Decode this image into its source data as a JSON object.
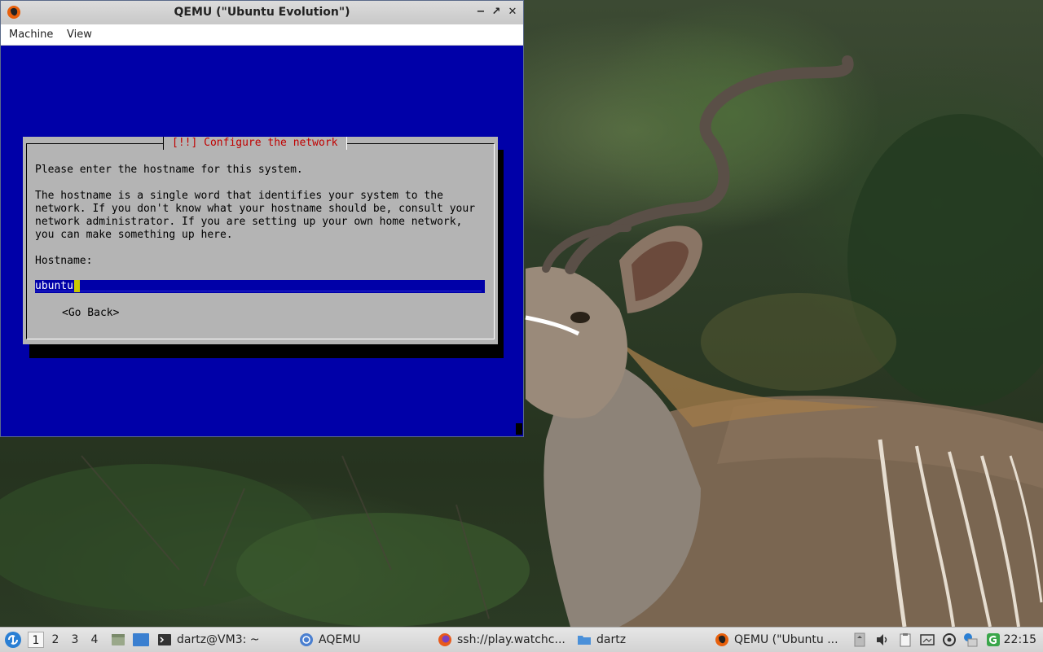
{
  "window": {
    "title": "QEMU (\"Ubuntu Evolution\")",
    "controls": {
      "minimize": "−",
      "maximize": "↗",
      "close": "✕"
    }
  },
  "menu": {
    "machine": "Machine",
    "view": "View"
  },
  "installer": {
    "dialog_title": "[!!] Configure the network",
    "prompt": "Please enter the hostname for this system.",
    "description_lines": [
      "The hostname is a single word that identifies your system to the",
      "network. If you don't know what your hostname should be, consult your",
      "network administrator. If you are setting up your own home network,",
      "you can make something up here."
    ],
    "field_label": "Hostname:",
    "hostname_value": "ubuntu",
    "go_back": "<Go Back>"
  },
  "taskbar": {
    "desktops": [
      "1",
      "2",
      "3",
      "4"
    ],
    "active_desktop": "1",
    "tasks": [
      {
        "label": "dartz@VM3: ~",
        "icon": "terminal-icon"
      },
      {
        "label": "AQEMU",
        "icon": "aqemu-icon"
      },
      {
        "label": "ssh://play.watchc...",
        "icon": "firefox-icon"
      },
      {
        "label": "dartz",
        "icon": "folder-icon"
      },
      {
        "label": "QEMU (\"Ubuntu ...",
        "icon": "qemu-icon",
        "active": true
      }
    ],
    "clock": "22:15"
  },
  "colors": {
    "vm_background": "#0000a8",
    "dialog_background": "#b4b4b4",
    "dialog_title": "#c00000",
    "cursor": "#c8c800"
  }
}
